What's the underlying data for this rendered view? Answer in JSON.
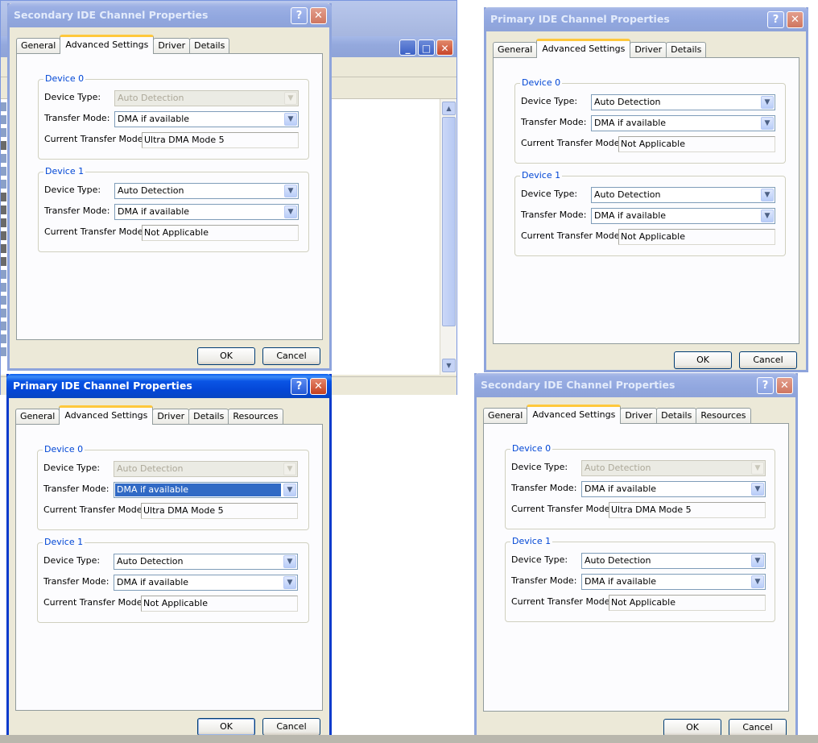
{
  "dialogs": {
    "tl": {
      "title": "Secondary IDE Channel Properties",
      "tabs": [
        "General",
        "Advanced Settings",
        "Driver",
        "Details"
      ],
      "device0": {
        "legend": "Device 0",
        "device_type_label": "Device Type:",
        "device_type": "Auto Detection",
        "transfer_mode_label": "Transfer Mode:",
        "transfer_mode": "DMA if available",
        "current_label": "Current Transfer Mode:",
        "current": "Ultra DMA Mode 5"
      },
      "device1": {
        "legend": "Device 1",
        "device_type_label": "Device Type:",
        "device_type": "Auto Detection",
        "transfer_mode_label": "Transfer Mode:",
        "transfer_mode": "DMA if available",
        "current_label": "Current Transfer Mode:",
        "current": "Not Applicable"
      },
      "ok": "OK",
      "cancel": "Cancel"
    },
    "tr": {
      "title": "Primary IDE Channel Properties",
      "tabs": [
        "General",
        "Advanced Settings",
        "Driver",
        "Details"
      ],
      "device0": {
        "legend": "Device 0",
        "device_type_label": "Device Type:",
        "device_type": "Auto Detection",
        "transfer_mode_label": "Transfer Mode:",
        "transfer_mode": "DMA if available",
        "current_label": "Current Transfer Mode:",
        "current": "Not Applicable"
      },
      "device1": {
        "legend": "Device 1",
        "device_type_label": "Device Type:",
        "device_type": "Auto Detection",
        "transfer_mode_label": "Transfer Mode:",
        "transfer_mode": "DMA if available",
        "current_label": "Current Transfer Mode:",
        "current": "Not Applicable"
      },
      "ok": "OK",
      "cancel": "Cancel"
    },
    "bl": {
      "title": "Primary IDE Channel Properties",
      "tabs": [
        "General",
        "Advanced Settings",
        "Driver",
        "Details",
        "Resources"
      ],
      "device0": {
        "legend": "Device 0",
        "device_type_label": "Device Type:",
        "device_type": "Auto Detection",
        "transfer_mode_label": "Transfer Mode:",
        "transfer_mode": "DMA if available",
        "current_label": "Current Transfer Mode:",
        "current": "Ultra DMA Mode 5"
      },
      "device1": {
        "legend": "Device 1",
        "device_type_label": "Device Type:",
        "device_type": "Auto Detection",
        "transfer_mode_label": "Transfer Mode:",
        "transfer_mode": "DMA if available",
        "current_label": "Current Transfer Mode:",
        "current": "Not Applicable"
      },
      "ok": "OK",
      "cancel": "Cancel"
    },
    "br": {
      "title": "Secondary IDE Channel Properties",
      "tabs": [
        "General",
        "Advanced Settings",
        "Driver",
        "Details",
        "Resources"
      ],
      "device0": {
        "legend": "Device 0",
        "device_type_label": "Device Type:",
        "device_type": "Auto Detection",
        "transfer_mode_label": "Transfer Mode:",
        "transfer_mode": "DMA if available",
        "current_label": "Current Transfer Mode:",
        "current": "Ultra DMA Mode 5"
      },
      "device1": {
        "legend": "Device 1",
        "device_type_label": "Device Type:",
        "device_type": "Auto Detection",
        "transfer_mode_label": "Transfer Mode:",
        "transfer_mode": "DMA if available",
        "current_label": "Current Transfer Mode:",
        "current": "Not Applicable"
      },
      "ok": "OK",
      "cancel": "Cancel"
    }
  },
  "icons": {
    "help": "help-icon",
    "close": "close-icon",
    "dropdown": "chevron-down-icon"
  },
  "colors": {
    "active_title": "#0a46d5",
    "inactive_title": "#8ea3d9",
    "group_legend": "#0046d5",
    "tab_accent": "#ffc83c",
    "selection": "#316ac5"
  }
}
